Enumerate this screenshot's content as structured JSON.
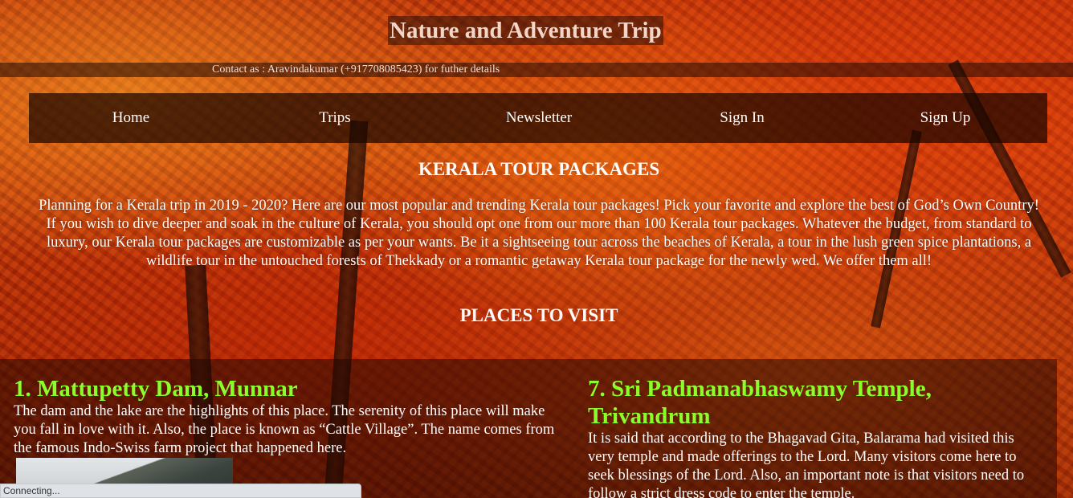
{
  "header": {
    "title": "Nature and Adventure Trip",
    "contact": "Contact as : Aravindakumar (+917708085423) for futher details"
  },
  "nav": {
    "items": [
      "Home",
      "Trips",
      "Newsletter",
      "Sign In",
      "Sign Up"
    ]
  },
  "main": {
    "packages_heading": "KERALA TOUR PACKAGES",
    "intro": "Planning for a Kerala trip in 2019 - 2020? Here are our most popular and trending Kerala tour packages! Pick your favorite and explore the best of God’s Own Country! If you wish to dive deeper and soak in the culture of Kerala, you should opt one from our more than 100 Kerala tour packages. Whatever the budget, from standard to luxury, our Kerala tour packages are customizable as per your wants. Be it a sightseeing tour across the beaches of Kerala, a tour in the lush green spice plantations, a wildlife tour in the untouched forests of Thekkady or a romantic getaway Kerala tour package for the newly wed. We offer them all!",
    "places_heading": "PLACES TO VISIT",
    "places": [
      {
        "title": "1. Mattupetty Dam, Munnar",
        "description": "The dam and the lake are the highlights of this place. The serenity of this place will make you fall in love with it. Also, the place is known as “Cattle Village”. The name comes from the famous Indo-Swiss farm project that happened here."
      },
      {
        "title": "7. Sri Padmanabhaswamy Temple, Trivandrum",
        "description": "It is said that according to the Bhagavad Gita, Balarama had visited this very temple and made offerings to the Lord. Many visitors come here to seek blessings of the Lord. Also, an important note is that visitors need to follow a strict dress code to enter the temple."
      }
    ]
  },
  "status_bar": {
    "text": "Connecting..."
  },
  "colors": {
    "place_title": "#8bff2c",
    "nav_background": "#190500"
  }
}
